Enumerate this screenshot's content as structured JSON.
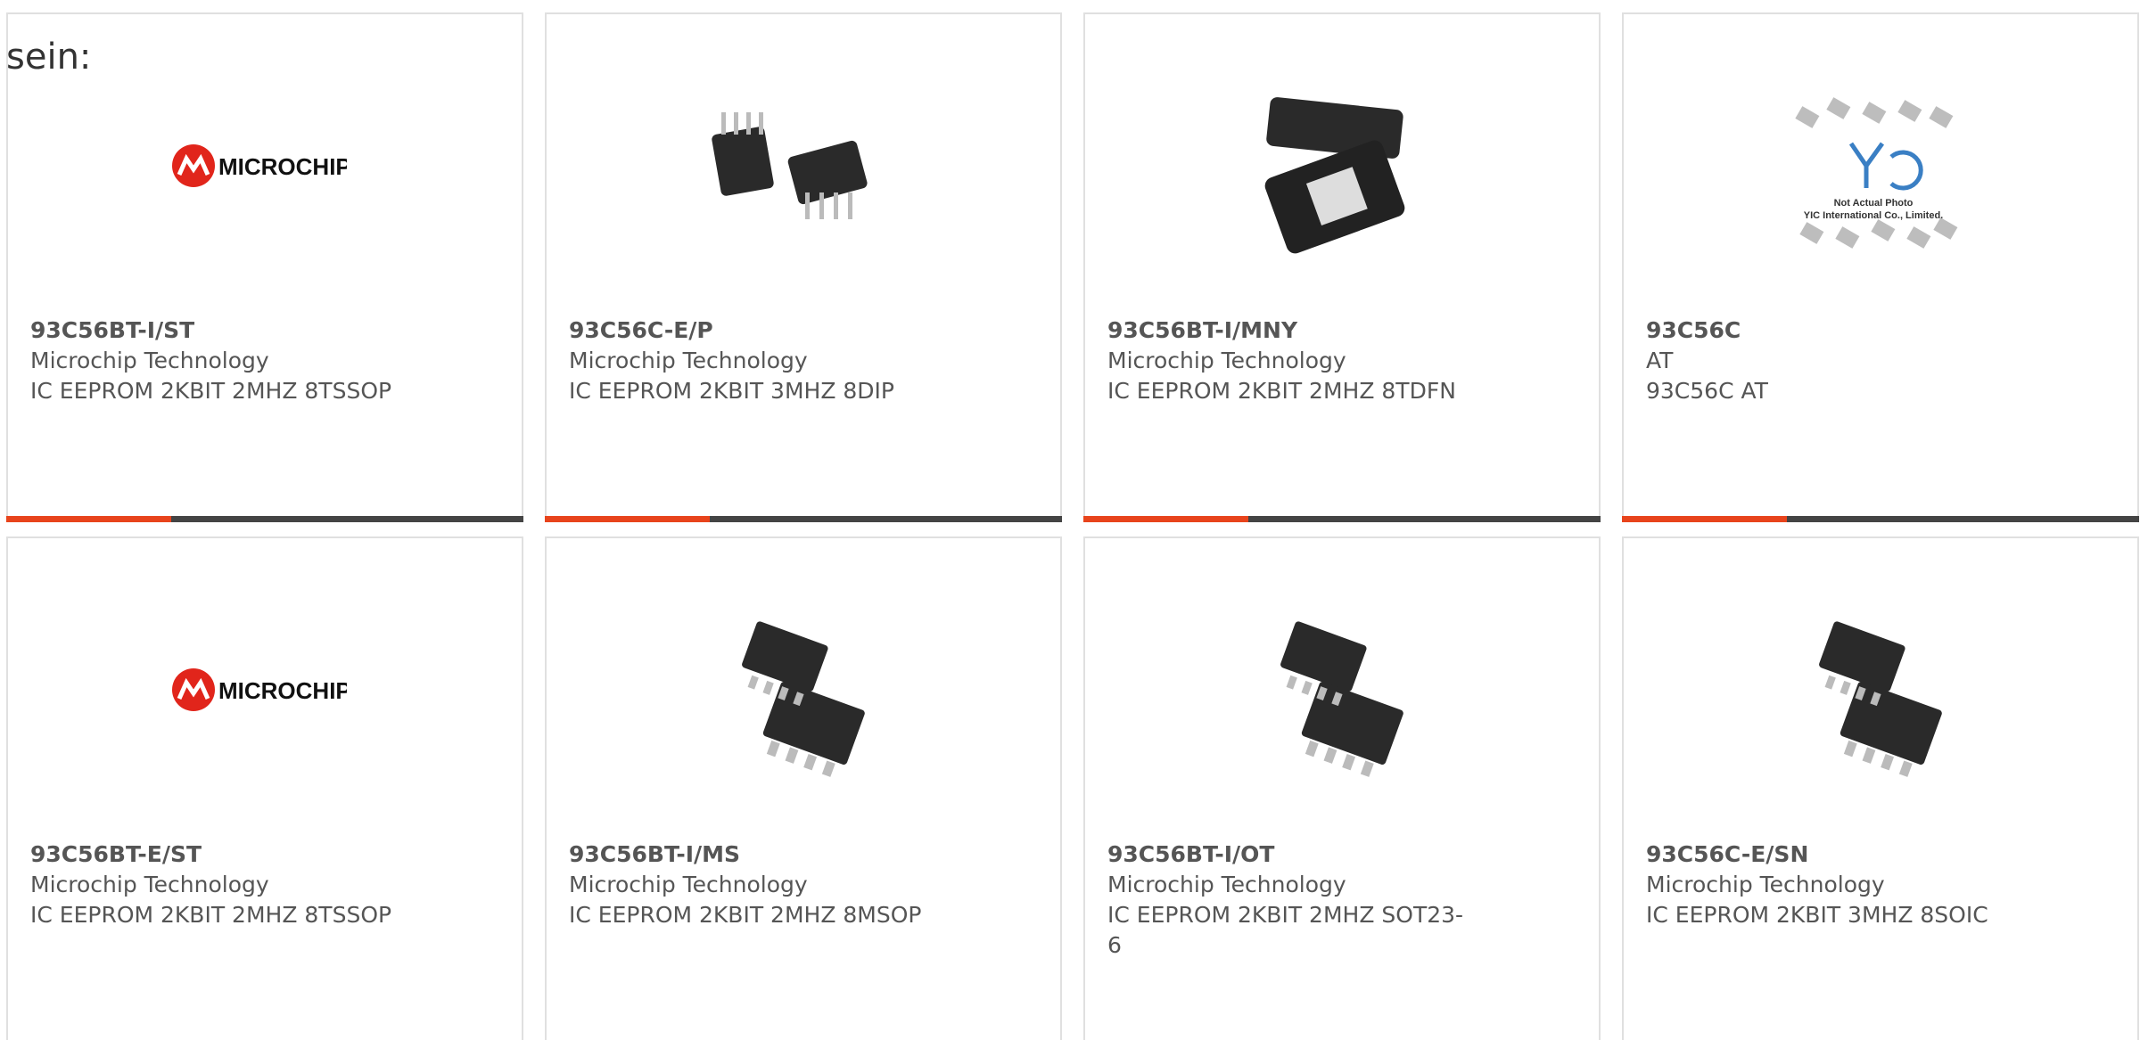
{
  "intro": "sein:",
  "products": [
    {
      "part": "93C56BT-I/ST",
      "manufacturer": "Microchip Technology",
      "description": "IC EEPROM 2KBIT 2MHZ 8TSSOP",
      "image": "microchip-logo"
    },
    {
      "part": "93C56C-E/P",
      "manufacturer": "Microchip Technology",
      "description": "IC EEPROM 2KBIT 3MHZ 8DIP",
      "image": "dip-chip"
    },
    {
      "part": "93C56BT-I/MNY",
      "manufacturer": "Microchip Technology",
      "description": "IC EEPROM 2KBIT 2MHZ 8TDFN",
      "image": "tdfn-chip"
    },
    {
      "part": "93C56C",
      "manufacturer": "AT",
      "description": "93C56C AT",
      "image": "yic-placeholder",
      "image_text": [
        "Not Actual Photo",
        "YIC International Co., Limited."
      ]
    },
    {
      "part": "93C56BT-E/ST",
      "manufacturer": "Microchip Technology",
      "description": "IC EEPROM 2KBIT 2MHZ 8TSSOP",
      "image": "microchip-logo"
    },
    {
      "part": "93C56BT-I/MS",
      "manufacturer": "Microchip Technology",
      "description": "IC EEPROM 2KBIT 2MHZ 8MSOP",
      "image": "msop-chip"
    },
    {
      "part": "93C56BT-I/OT",
      "manufacturer": "Microchip Technology",
      "description": "IC EEPROM 2KBIT 2MHZ SOT23-\n6",
      "image": "sot23-chip"
    },
    {
      "part": "93C56C-E/SN",
      "manufacturer": "Microchip Technology",
      "description": "IC EEPROM 2KBIT 3MHZ 8SOIC",
      "image": "soic-chip"
    }
  ],
  "logo_text": "Microchip",
  "colors": {
    "accent": "#e8441c",
    "bar": "#444444",
    "border": "#e0e0e0",
    "text": "#555555"
  }
}
